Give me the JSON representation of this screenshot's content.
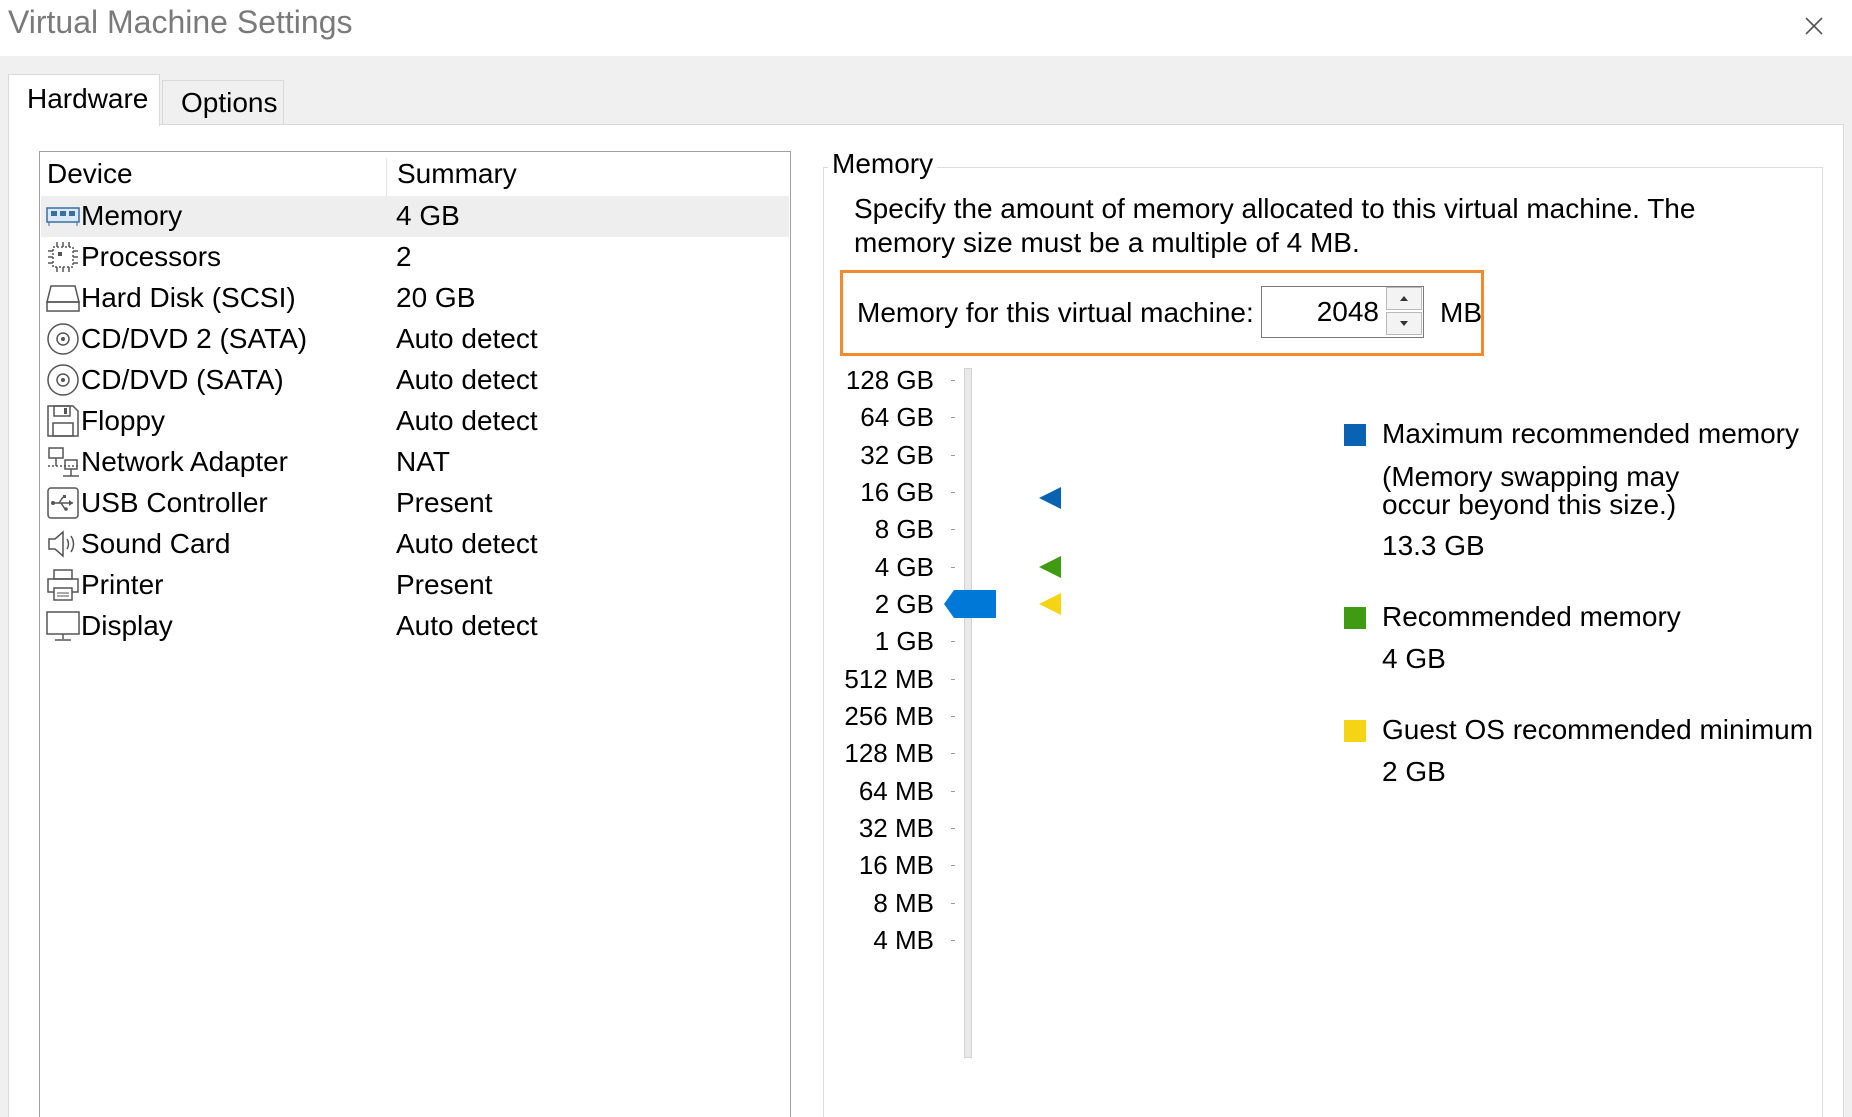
{
  "window": {
    "title": "Virtual Machine Settings"
  },
  "tabs": [
    {
      "label": "Hardware",
      "active": true
    },
    {
      "label": "Options",
      "active": false
    }
  ],
  "device_list": {
    "headers": {
      "device": "Device",
      "summary": "Summary"
    },
    "rows": [
      {
        "name": "Memory",
        "summary": "4 GB",
        "icon": "memory-icon",
        "selected": true
      },
      {
        "name": "Processors",
        "summary": "2",
        "icon": "processor-icon"
      },
      {
        "name": "Hard Disk (SCSI)",
        "summary": "20 GB",
        "icon": "hard-disk-icon"
      },
      {
        "name": "CD/DVD 2 (SATA)",
        "summary": "Auto detect",
        "icon": "cd-dvd-icon"
      },
      {
        "name": "CD/DVD (SATA)",
        "summary": "Auto detect",
        "icon": "cd-dvd-icon"
      },
      {
        "name": "Floppy",
        "summary": "Auto detect",
        "icon": "floppy-icon"
      },
      {
        "name": "Network Adapter",
        "summary": "NAT",
        "icon": "network-adapter-icon"
      },
      {
        "name": "USB Controller",
        "summary": "Present",
        "icon": "usb-icon"
      },
      {
        "name": "Sound Card",
        "summary": "Auto detect",
        "icon": "speaker-icon"
      },
      {
        "name": "Printer",
        "summary": "Present",
        "icon": "printer-icon"
      },
      {
        "name": "Display",
        "summary": "Auto detect",
        "icon": "display-icon"
      }
    ]
  },
  "memory": {
    "group_title": "Memory",
    "description": "Specify the amount of memory allocated to this virtual machine. The memory size must be a multiple of 4 MB.",
    "field_label": "Memory for this virtual machine:",
    "value": "2048",
    "unit": "MB",
    "highlight_color": "#f08a2c",
    "slider": {
      "ticks": [
        "128 GB",
        "64 GB",
        "32 GB",
        "16 GB",
        "8 GB",
        "4 GB",
        "2 GB",
        "1 GB",
        "512 MB",
        "256 MB",
        "128 MB",
        "64 MB",
        "32 MB",
        "16 MB",
        "8 MB",
        "4 MB"
      ],
      "current": "2 GB",
      "max_recommended_marker": "16 GB",
      "recommended_marker": "4 GB",
      "guest_min_marker": "2 GB",
      "thumb_color": "#0078d7"
    },
    "legend": {
      "max_recommended": {
        "title": "Maximum recommended memory",
        "note_line1": "(Memory swapping may",
        "note_line2": "occur beyond this size.)",
        "value": "13.3 GB",
        "color": "#0a62b3"
      },
      "recommended": {
        "title": "Recommended memory",
        "value": "4 GB",
        "color": "#3e9b12"
      },
      "guest_min": {
        "title": "Guest OS recommended minimum",
        "value": "2 GB",
        "color": "#f5d415"
      }
    }
  }
}
